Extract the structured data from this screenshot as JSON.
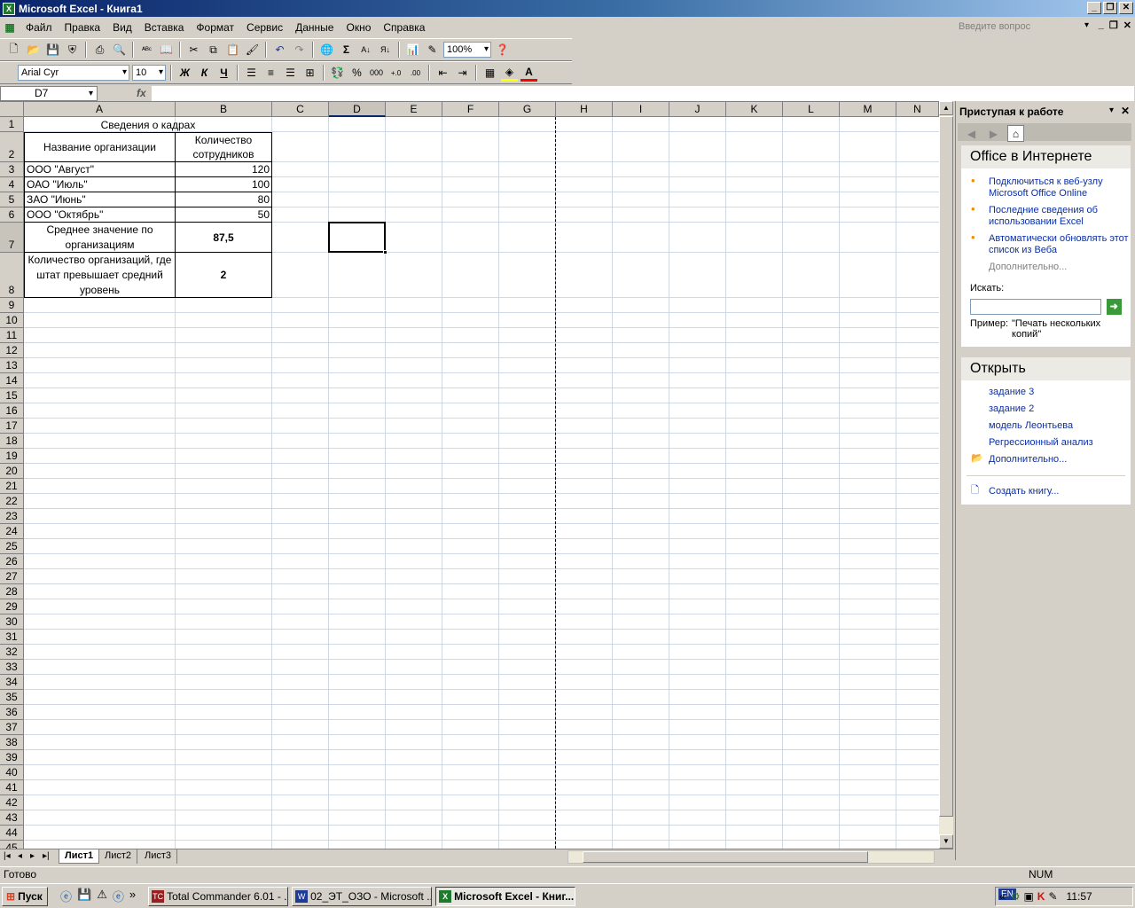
{
  "window": {
    "title": "Microsoft Excel - Книга1",
    "ask_placeholder": "Введите вопрос"
  },
  "menu": [
    "Файл",
    "Правка",
    "Вид",
    "Вставка",
    "Формат",
    "Сервис",
    "Данные",
    "Окно",
    "Справка"
  ],
  "toolbar": {
    "zoom": "100%",
    "font_name": "Arial Cyr",
    "font_size": "10",
    "bold_label": "Ж",
    "italic_label": "К",
    "underline_label": "Ч"
  },
  "formula_bar": {
    "name_box": "D7",
    "fx_label": "fx",
    "value": ""
  },
  "sheet": {
    "columns": [
      "A",
      "B",
      "C",
      "D",
      "E",
      "F",
      "G",
      "H",
      "I",
      "J",
      "K",
      "L",
      "M",
      "N"
    ],
    "rows": [
      "1",
      "2",
      "3",
      "4",
      "5",
      "6",
      "7",
      "8",
      "9",
      "10",
      "11",
      "12",
      "13",
      "14",
      "15",
      "16",
      "17",
      "18",
      "19",
      "20",
      "21",
      "22",
      "23",
      "24",
      "25",
      "26",
      "27",
      "28",
      "29",
      "30",
      "31",
      "32",
      "33",
      "34",
      "35",
      "36",
      "37",
      "38",
      "39",
      "40",
      "41",
      "42",
      "43",
      "44",
      "45"
    ],
    "selected_cell": "D7",
    "table_title": "Сведения о кадрах",
    "header_name": "Название организации",
    "header_count": "Количество сотрудников",
    "orgs": [
      {
        "name": "ООО \"Август\"",
        "count": "120"
      },
      {
        "name": "ОАО \"Июль\"",
        "count": "100"
      },
      {
        "name": "ЗАО \"Июнь\"",
        "count": "80"
      },
      {
        "name": "ООО \"Октябрь\"",
        "count": "50"
      }
    ],
    "avg_label": "Среднее значение по организациям",
    "avg_value": "87,5",
    "above_label": "Количество организаций, где штат превышает средний уровень",
    "above_value": "2"
  },
  "tabs": [
    "Лист1",
    "Лист2",
    "Лист3"
  ],
  "active_tab": "Лист1",
  "task_pane": {
    "title": "Приступая к работе",
    "section_online": "Office в Интернете",
    "online_links": [
      "Подключиться к веб-узлу Microsoft Office Online",
      "Последние сведения об использовании Excel",
      "Автоматически обновлять этот список из Веба"
    ],
    "more_online": "Дополнительно...",
    "search_label": "Искать:",
    "example_label": "Пример:",
    "example_text": "\"Печать нескольких копий\"",
    "section_open": "Открыть",
    "recent_files": [
      "задание 3",
      "задание 2",
      "модель Леонтьева",
      "Регрессионный анализ"
    ],
    "more_files": "Дополнительно...",
    "create_book": "Создать книгу..."
  },
  "status": {
    "left": "Готово",
    "num": "NUM"
  },
  "taskbar": {
    "start": "Пуск",
    "buttons": [
      "Total Commander 6.01 - ...",
      "02_ЭТ_ОЗО - Microsoft ...",
      "Microsoft Excel - Книг..."
    ],
    "lang": "EN",
    "clock": "11:57"
  }
}
